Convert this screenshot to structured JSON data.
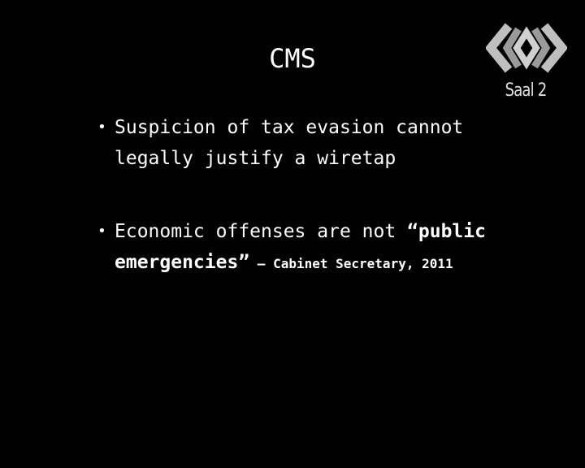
{
  "slide": {
    "title": "CMS",
    "bullets": [
      {
        "text": "Suspicion of tax evasion cannot legally justify a wiretap"
      },
      {
        "text_plain": "Economic offenses are not ",
        "text_bold": "“public emergencies”",
        "attribution": " – Cabinet Secretary, 2011"
      }
    ]
  },
  "logo": {
    "icon": "fahrplan-logo-icon",
    "caption": "Saal 2",
    "colors": {
      "primary": "#bfbfbf",
      "shadow": "#8a8a8a"
    }
  }
}
